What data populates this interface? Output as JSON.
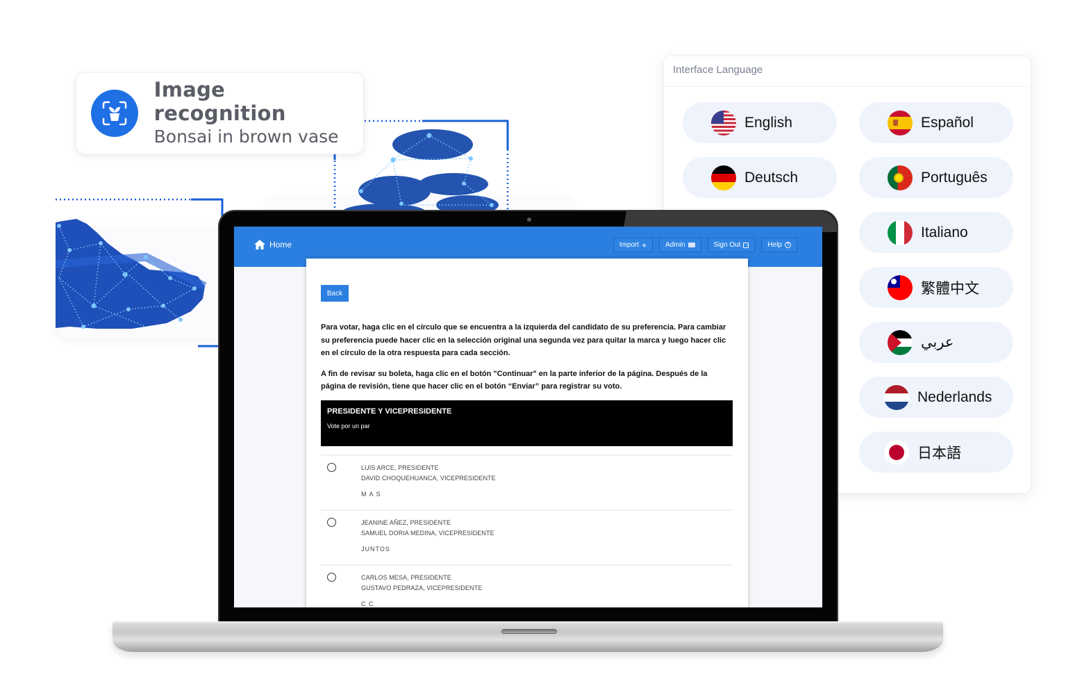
{
  "recognition_card": {
    "title": "Image recognition",
    "subtitle": "Bonsai in brown vase",
    "icon": "plant-scan-icon",
    "accent": "#1f6fe5"
  },
  "language_panel": {
    "title": "Interface Language",
    "languages": [
      {
        "label": "English",
        "flag": "us-flag-icon"
      },
      {
        "label": "Español",
        "flag": "spain-flag-icon"
      },
      {
        "label": "Deutsch",
        "flag": "germany-flag-icon"
      },
      {
        "label": "Português",
        "flag": "portugal-flag-icon"
      },
      {
        "label": "Italiano",
        "flag": "italy-flag-icon"
      },
      {
        "label": "繁體中文",
        "flag": "taiwan-flag-icon"
      },
      {
        "label": "عربي",
        "flag": "arabic-flag-icon"
      },
      {
        "label": "Nederlands",
        "flag": "netherlands-flag-icon"
      },
      {
        "label": "日本語",
        "flag": "japan-flag-icon"
      }
    ]
  },
  "app": {
    "brand_color": "#2b7fe0",
    "nav": {
      "home_label": "Home",
      "buttons": [
        {
          "label": "Import",
          "icon": "plus-icon"
        },
        {
          "label": "Admin",
          "icon": "card-icon"
        },
        {
          "label": "Sign Out",
          "icon": "sign-out-icon"
        },
        {
          "label": "Help",
          "icon": "help-icon"
        }
      ]
    },
    "back_label": "Back",
    "instructions": [
      "Para votar, haga clic en el círculo que se encuentra a la izquierda del candidato de su preferencia. Para cambiar su preferencia puede hacer clic en la selección original una segunda vez para quitar la marca y luego hacer clic en el círculo de la otra respuesta para cada sección.",
      "A fin de revisar su boleta, haga clic en el botón \"Continuar\" en la parte inferior de la página. Después de la página de revisión, tiene que hacer clic en el botón “Enviar” para registrar su voto."
    ],
    "contest": {
      "title": "PRESIDENTE Y VICEPRESIDENTE",
      "subtitle": "Vote por un par"
    },
    "candidates": [
      {
        "president": "LUIS ARCE, PRESIDENTE",
        "vice": "DAVID CHOQUEHUANCA, VICEPRESIDENTE",
        "party": "M A S"
      },
      {
        "president": "JEANINE AÑEZ, PRESIDENTE",
        "vice": "SAMUEL DORIA MEDINA, VICEPRESIDENTE",
        "party": "JUNTOS"
      },
      {
        "president": "CARLOS MESA, PRESIDENTE",
        "vice": "GUSTAVO PEDRAZA, VICEPRESIDENTE",
        "party": "C C"
      }
    ]
  }
}
